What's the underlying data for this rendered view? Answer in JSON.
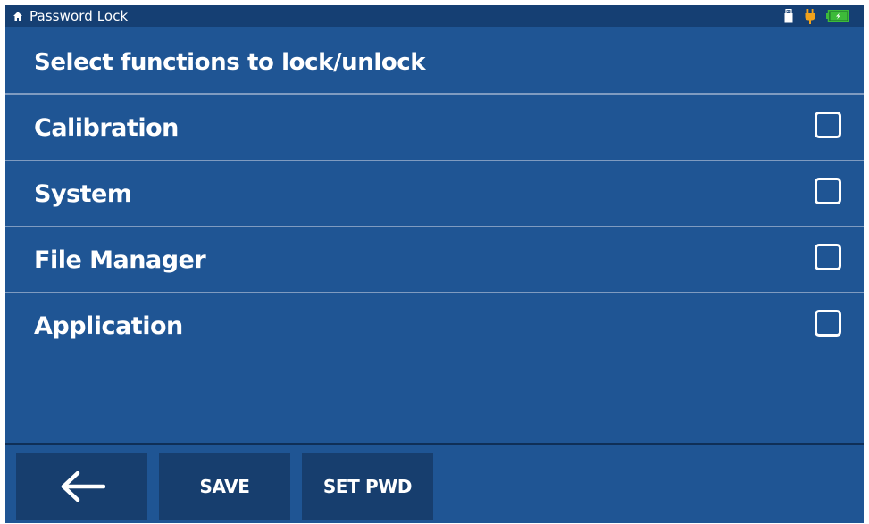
{
  "statusbar": {
    "title": "Password Lock",
    "home_icon": "home-icon",
    "usb_icon": "usb-drive-icon",
    "plug_icon": "power-plug-icon",
    "battery_icon": "battery-charging-icon",
    "colors": {
      "plug": "#f0a21c",
      "battery": "#3dbb3a"
    }
  },
  "header": {
    "title": "Select functions to lock/unlock"
  },
  "functions": [
    {
      "label": "Calibration",
      "checked": false
    },
    {
      "label": "System",
      "checked": false
    },
    {
      "label": "File Manager",
      "checked": false
    },
    {
      "label": "Application",
      "checked": false
    }
  ],
  "toolbar": {
    "back_icon": "left-arrow-icon",
    "save_label": "SAVE",
    "set_pwd_label": "SET PWD"
  },
  "colors": {
    "background": "#1f5594",
    "statusbar": "#153f73",
    "button": "#173e6e",
    "divider": "#7f9bc0"
  }
}
